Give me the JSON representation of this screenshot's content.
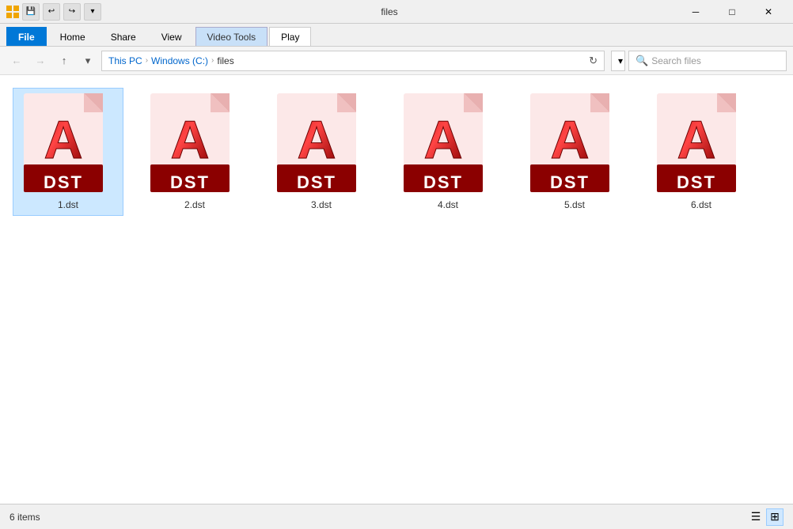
{
  "titleBar": {
    "title": "files",
    "minimize": "─",
    "maximize": "□",
    "close": "✕"
  },
  "ribbon": {
    "videoToolsLabel": "Video Tools",
    "tabs": [
      {
        "label": "File",
        "type": "file"
      },
      {
        "label": "Home",
        "type": "normal"
      },
      {
        "label": "Share",
        "type": "normal"
      },
      {
        "label": "View",
        "type": "normal"
      },
      {
        "label": "Play",
        "type": "normal",
        "active": true
      }
    ]
  },
  "addressBar": {
    "path": [
      "This PC",
      "Windows (C:)",
      "files"
    ],
    "searchPlaceholder": "Search files"
  },
  "files": [
    {
      "name": "1.dst",
      "selected": true
    },
    {
      "name": "2.dst",
      "selected": false
    },
    {
      "name": "3.dst",
      "selected": false
    },
    {
      "name": "4.dst",
      "selected": false
    },
    {
      "name": "5.dst",
      "selected": false
    },
    {
      "name": "6.dst",
      "selected": false
    }
  ],
  "statusBar": {
    "count": "6 items"
  }
}
